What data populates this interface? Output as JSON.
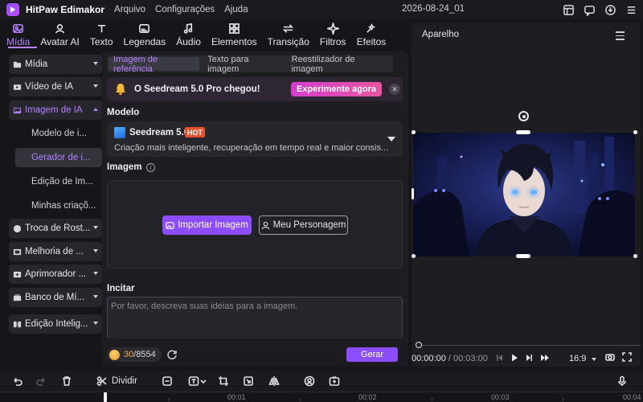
{
  "app": {
    "title": "HitPaw Edimakor",
    "menu": [
      "Arquivo",
      "Configurações",
      "Ajuda"
    ],
    "project_name": "2026-08-24_01"
  },
  "tabs": [
    {
      "label": "Mídia",
      "icon": "media-icon",
      "active": true
    },
    {
      "label": "Avatar AI",
      "icon": "avatar-icon"
    },
    {
      "label": "Texto",
      "icon": "text-icon"
    },
    {
      "label": "Legendas",
      "icon": "subtitles-icon"
    },
    {
      "label": "Áudio",
      "icon": "music-note-icon"
    },
    {
      "label": "Elementos",
      "icon": "elements-icon"
    },
    {
      "label": "Transição",
      "icon": "transition-icon"
    },
    {
      "label": "Filtros",
      "icon": "sparkle-icon"
    },
    {
      "label": "Efeitos",
      "icon": "effects-icon"
    }
  ],
  "sidebar": {
    "items": [
      {
        "label": "Mídia",
        "icon": "folder-icon"
      },
      {
        "label": "Vídeo de IA",
        "icon": "video-icon"
      },
      {
        "label": "Imagem de IA",
        "icon": "image-icon",
        "open": true
      },
      {
        "label": "Troca de Rost...",
        "icon": "face-swap-icon"
      },
      {
        "label": "Melhoria de ...",
        "icon": "enhance-icon"
      },
      {
        "label": "Aprimorador ...",
        "icon": "enhancer-icon"
      },
      {
        "label": "Banco de Mí...",
        "icon": "media-bank-icon"
      },
      {
        "label": "Edição Intelig...",
        "icon": "smart-edit-icon"
      }
    ],
    "sub_items": [
      {
        "label": "Modelo de i..."
      },
      {
        "label": "Gerador de i...",
        "selected": true
      },
      {
        "label": "Edição de Im..."
      },
      {
        "label": "Minhas criaçõ..."
      }
    ]
  },
  "panel": {
    "subtabs": [
      "Imagem de referência",
      "Texto para imagem",
      "Reestilizador de imagem"
    ],
    "banner": {
      "text": "O Seedream 5.0 Pro chegou!",
      "button": "Experimente agora"
    },
    "model_label": "Modelo",
    "model": {
      "name": "Seedream 5.0",
      "badge": "HOT",
      "description": "Criação mais inteligente, recuperação em tempo real e maior consis..."
    },
    "image_label": "Imagem",
    "import_button": "Importar Imagem",
    "character_button": "Meu Personagem",
    "prompt_label": "Incitar",
    "prompt_placeholder": "Por favor, descreva suas ideias para a imagem.",
    "credits": {
      "used": "30",
      "total": "/8554"
    },
    "generate_button": "Gerar"
  },
  "player": {
    "title": "Aparelho",
    "time_current": "00:00:00",
    "time_total": "/ 00:03:00",
    "aspect_ratio": "16:9"
  },
  "timeline": {
    "split_label": "Dividir",
    "ruler": [
      "00:01",
      "00:02",
      "00:03",
      "00:04"
    ]
  },
  "colors": {
    "accent": "#b481ff",
    "primary_button": "#8c4dff",
    "hot_badge": "#e5502e"
  }
}
